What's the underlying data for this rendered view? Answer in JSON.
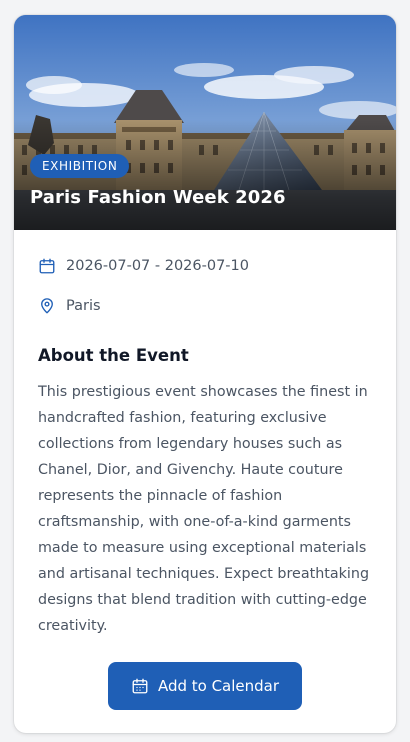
{
  "event": {
    "category": "EXHIBITION",
    "title": "Paris Fashion Week 2026",
    "dates": "2026-07-07 - 2026-07-10",
    "location": "Paris",
    "hero_image_icon": "louvre-photo"
  },
  "about": {
    "heading": "About the Event",
    "description": "This prestigious event showcases the finest in handcrafted fashion, featuring exclusive collections from legendary houses such as Chanel, Dior, and Givenchy. Haute couture represents the pinnacle of fashion craftsmanship, with one-of-a-kind garments made to measure using exceptional materials and artisanal techniques. Expect breathtaking designs that blend tradition with cutting-edge creativity."
  },
  "actions": {
    "add_to_calendar_label": "Add to Calendar"
  },
  "icons": {
    "dates": "calendar-icon",
    "location": "map-pin-icon",
    "button": "calendar-icon"
  },
  "colors": {
    "accent": "#1f5fb6",
    "text_primary": "#111827",
    "text_secondary": "#4b5563",
    "icon": "#1f5fb6"
  }
}
